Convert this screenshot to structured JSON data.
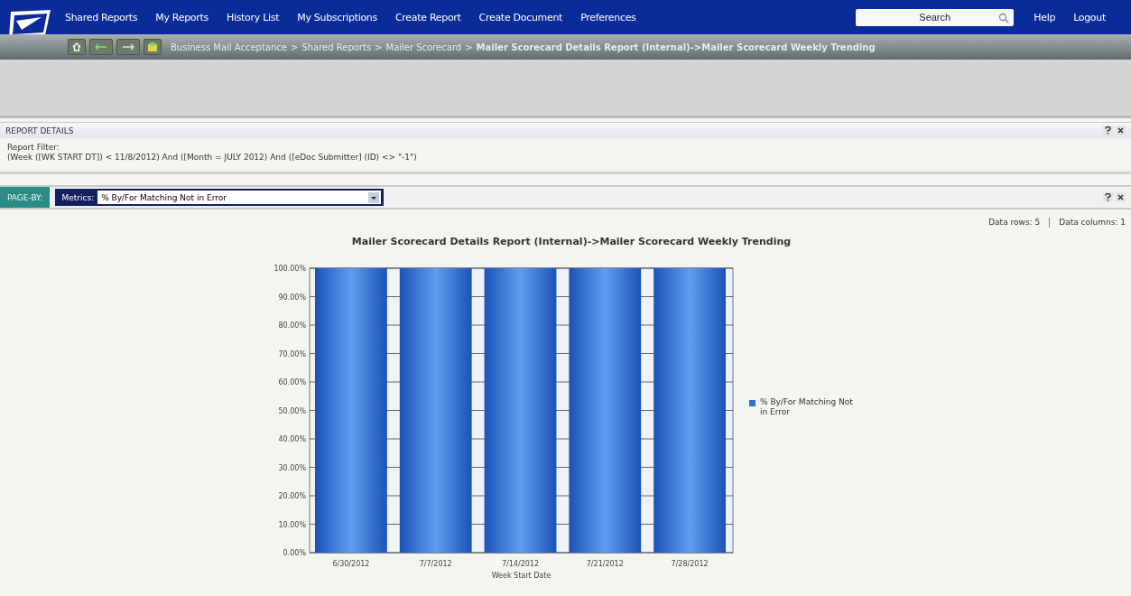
{
  "nav": {
    "items": [
      "Shared Reports",
      "My Reports",
      "History List",
      "My Subscriptions",
      "Create Report",
      "Create Document",
      "Preferences"
    ],
    "search": {
      "placeholder": "Search"
    },
    "links": [
      "Help",
      "Logout"
    ]
  },
  "breadcrumb_separator": ">",
  "breadcrumb": [
    {
      "label": "Business Mail Acceptance",
      "current": false
    },
    {
      "label": "Shared Reports",
      "current": false
    },
    {
      "label": "Mailer Scorecard",
      "current": false
    },
    {
      "label": "Mailer Scorecard Details Report (Internal)->Mailer Scorecard Weekly Trending",
      "current": true
    }
  ],
  "report_details": {
    "title": "REPORT DETAILS",
    "filter_label": "Report Filter:",
    "filter": "(Week ([WK START DT]) < 11/8/2012) And ([Month = JULY 2012) And ([eDoc Submitter] (ID) <> \"-1\")"
  },
  "page_by": {
    "label": "PAGE-BY:",
    "selector_label": "Metrics:",
    "value": "% By/For Matching Not in Error"
  },
  "stats": [
    "Data rows: 5",
    "Data columns: 1"
  ],
  "chart": {
    "chart_data": {
      "type": "bar",
      "title": "Mailer Scorecard Details Report (Internal)->Mailer Scorecard Weekly Trending",
      "xlabel": "Week Start Date",
      "categories": [
        "6/30/2012",
        "7/7/2012",
        "7/14/2012",
        "7/21/2012",
        "7/28/2012"
      ],
      "series": [
        {
          "name": "% By/For Matching Not in Error",
          "color": "#2f6fd6",
          "values": [
            100,
            100,
            100,
            100,
            100
          ]
        }
      ],
      "ylim": [
        0,
        100
      ],
      "grid": true,
      "legend": true,
      "yticks": [
        {
          "value": 0,
          "label": "0.00%"
        },
        {
          "value": 10,
          "label": "10.00%"
        },
        {
          "value": 20,
          "label": "20.00%"
        },
        {
          "value": 30,
          "label": "30.00%"
        },
        {
          "value": 40,
          "label": "40.00%"
        },
        {
          "value": 50,
          "label": "50.00%"
        },
        {
          "value": 60,
          "label": "60.00%"
        },
        {
          "value": 70,
          "label": "70.00%"
        },
        {
          "value": 80,
          "label": "80.00%"
        },
        {
          "value": 90,
          "label": "90.00%"
        },
        {
          "value": 100,
          "label": "100.00%"
        }
      ]
    }
  }
}
